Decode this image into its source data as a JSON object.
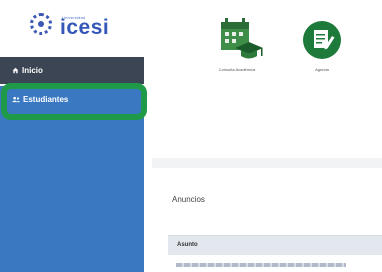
{
  "app": {
    "logo_small_text": "Universidad",
    "logo_word": "icesi"
  },
  "sidebar": {
    "items": [
      {
        "label": "Inicio",
        "icon": "home-icon"
      },
      {
        "label": "Estudiantes",
        "icon": "students-icon"
      }
    ],
    "selected_index": 1
  },
  "shortcuts": [
    {
      "label": "Consulta Académica",
      "icon": "calendar-graduation-icon"
    },
    {
      "label": "Agenda",
      "icon": "agenda-edit-icon"
    }
  ],
  "announcements": {
    "title": "Anuncios",
    "column_header": "Asunto"
  },
  "colors": {
    "sidebar_blue": "#3a78c2",
    "sidebar_dark": "#3b4554",
    "highlight_green": "#1f9a48",
    "brand_blue": "#3558b8"
  }
}
